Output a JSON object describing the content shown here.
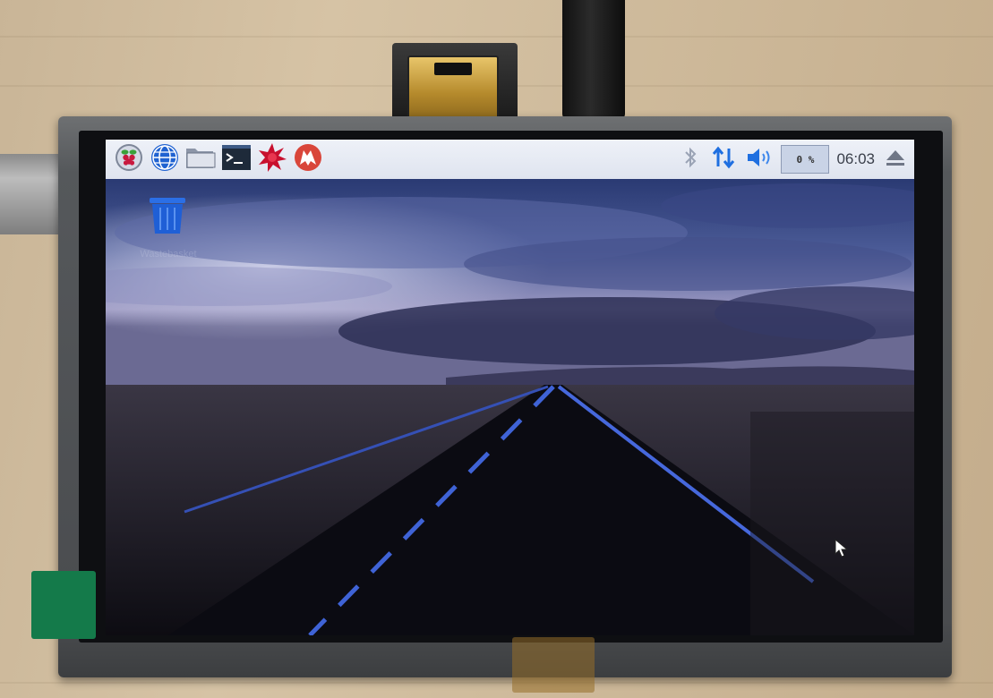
{
  "taskbar": {
    "launchers": [
      {
        "name": "raspberry-menu",
        "icon": "raspberry-icon"
      },
      {
        "name": "web-browser",
        "icon": "globe-icon"
      },
      {
        "name": "file-manager",
        "icon": "folder-icon"
      },
      {
        "name": "terminal",
        "icon": "terminal-icon"
      },
      {
        "name": "mathematica",
        "icon": "star-burst-icon"
      },
      {
        "name": "wolfram",
        "icon": "wolf-icon"
      }
    ],
    "tray": {
      "bluetooth_icon": "bluetooth-icon",
      "network_icon": "network-updown-icon",
      "volume_icon": "speaker-icon",
      "cpu_usage": "0 %",
      "clock": "06:03",
      "eject_icon": "eject-icon"
    }
  },
  "desktop": {
    "trash_icon": "trash-icon",
    "trash_label": "Wastebasket",
    "cursor": "mouse-pointer-icon"
  },
  "colors": {
    "panel": "#e4e8f2",
    "accent_blue": "#1f6fe0",
    "sky_top": "#2c3f78",
    "horizon": "#a7a3c6",
    "road": "#0b0b12",
    "road_line": "#3f63d6"
  }
}
